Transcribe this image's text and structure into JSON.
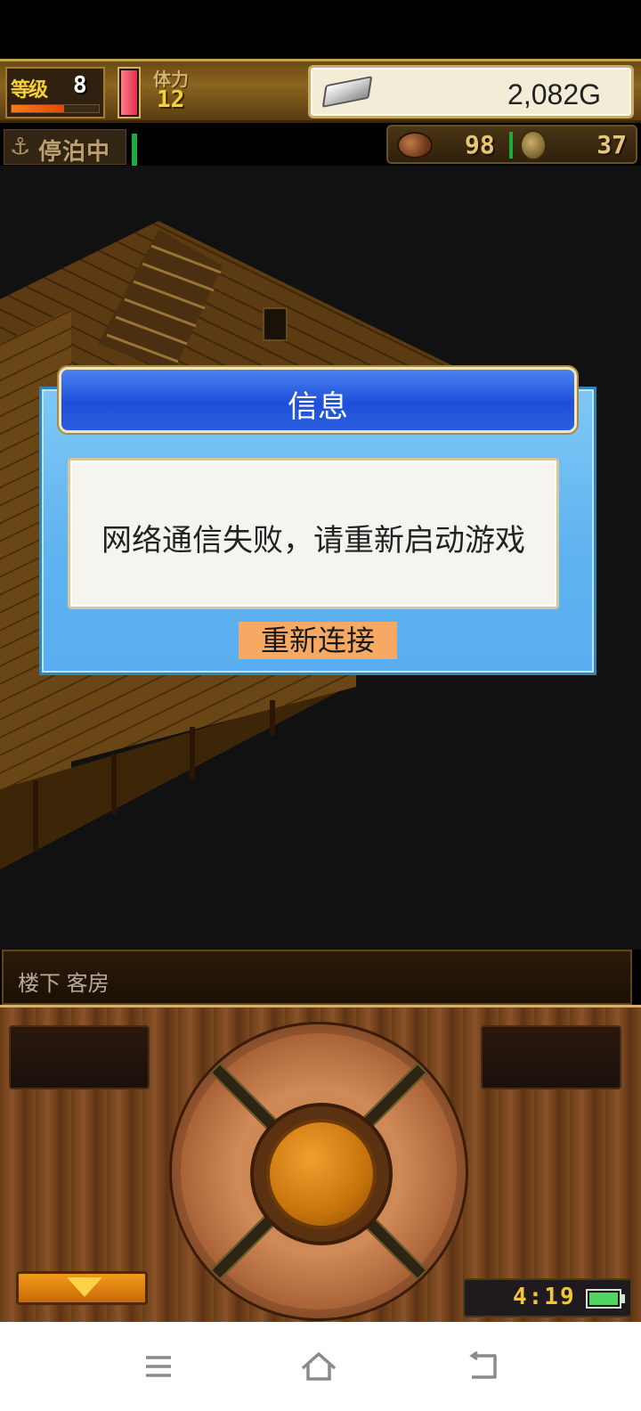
{
  "hud": {
    "level_label": "等级",
    "level_value": "8",
    "level_exp_fraction": 0.6,
    "stamina_gauge_fraction": 1.0,
    "stamina_label": "体力",
    "stamina_value": "12",
    "gold": "2,082G",
    "anchored_status": "停泊中",
    "resource_food": "98",
    "resource_coins": "37"
  },
  "dialog": {
    "title": "信息",
    "message": "网络通信失败，请重新启动游戏",
    "reconnect_label": "重新连接"
  },
  "location": {
    "text": "楼下 客房"
  },
  "controller": {
    "clock": "4:19",
    "battery_fraction": 1.0
  },
  "icons": {
    "silver": "silver-bar-icon",
    "anchor": "anchor-icon",
    "cannonball": "cannonball-icon",
    "coin": "coin-icon",
    "menu_toggle": "down-triangle-icon",
    "battery": "battery-icon",
    "nav_menu": "menu-icon",
    "nav_home": "home-icon",
    "nav_back": "back-icon"
  },
  "colors": {
    "dialog_bg": "#5eb2ef",
    "dialog_title_bg": "#1f4fd8",
    "reconnect_button": "#f7a964",
    "level_text": "#f4d13a",
    "clock_text": "#f3c63a"
  }
}
